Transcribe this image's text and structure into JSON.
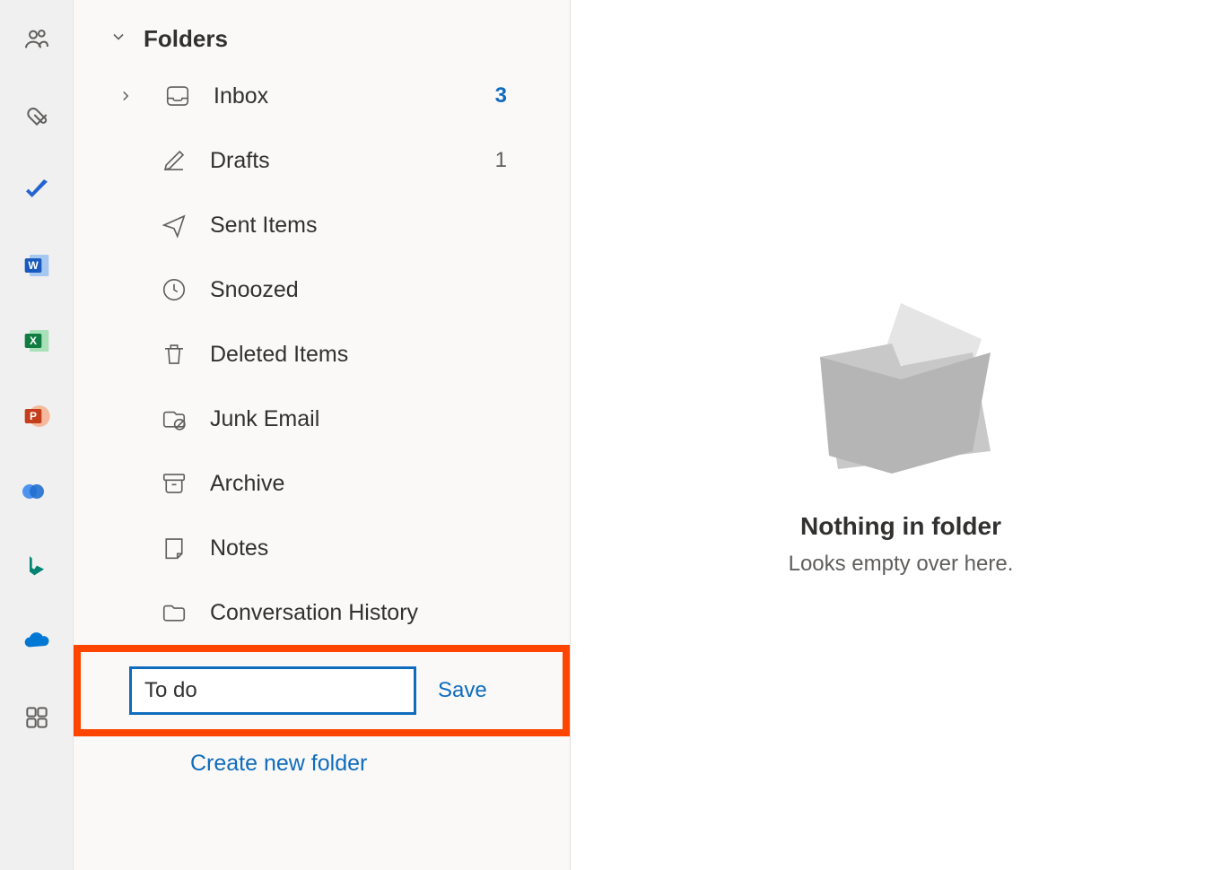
{
  "rail": {
    "items": [
      "people",
      "files",
      "todo",
      "word",
      "excel",
      "powerpoint",
      "viva",
      "bing",
      "onedrive",
      "more-apps"
    ]
  },
  "sidebar": {
    "header_label": "Folders",
    "items": [
      {
        "label": "Inbox",
        "count": "3",
        "unread": true
      },
      {
        "label": "Drafts",
        "count": "1"
      },
      {
        "label": "Sent Items"
      },
      {
        "label": "Snoozed"
      },
      {
        "label": "Deleted Items"
      },
      {
        "label": "Junk Email"
      },
      {
        "label": "Archive"
      },
      {
        "label": "Notes"
      },
      {
        "label": "Conversation History"
      }
    ],
    "new_folder_value": "To do",
    "save_label": "Save",
    "create_label": "Create new folder"
  },
  "empty": {
    "title": "Nothing in folder",
    "subtitle": "Looks empty over here."
  }
}
